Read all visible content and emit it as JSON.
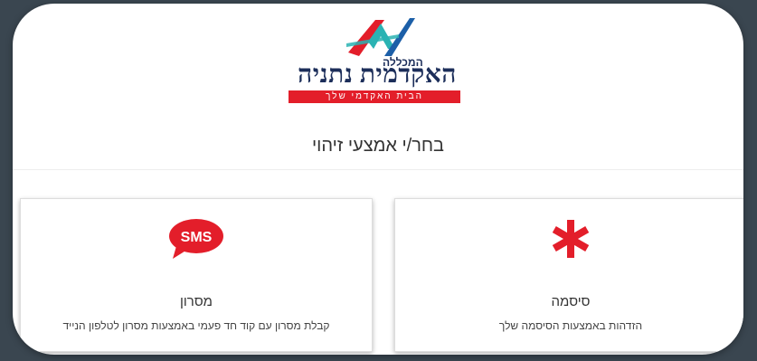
{
  "logo": {
    "small_text": "המכללה",
    "main_text": "האקדמית נתניה",
    "tagline": "הבית האקדמי שלך"
  },
  "heading": "בחר/י אמצעי זיהוי",
  "options": [
    {
      "icon": "sms-bubble-icon",
      "icon_text": "SMS",
      "title": "מסרון",
      "description": "קבלת מסרון עם קוד חד פעמי באמצעות מסרון לטלפון הנייד"
    },
    {
      "icon": "asterisk-icon",
      "title": "סיסמה",
      "description": "הזדהות באמצעות הסיסמה שלך"
    }
  ],
  "colors": {
    "brand_red": "#e31e2a",
    "brand_navy": "#1c2e5a",
    "brand_teal": "#2ab3b3"
  }
}
